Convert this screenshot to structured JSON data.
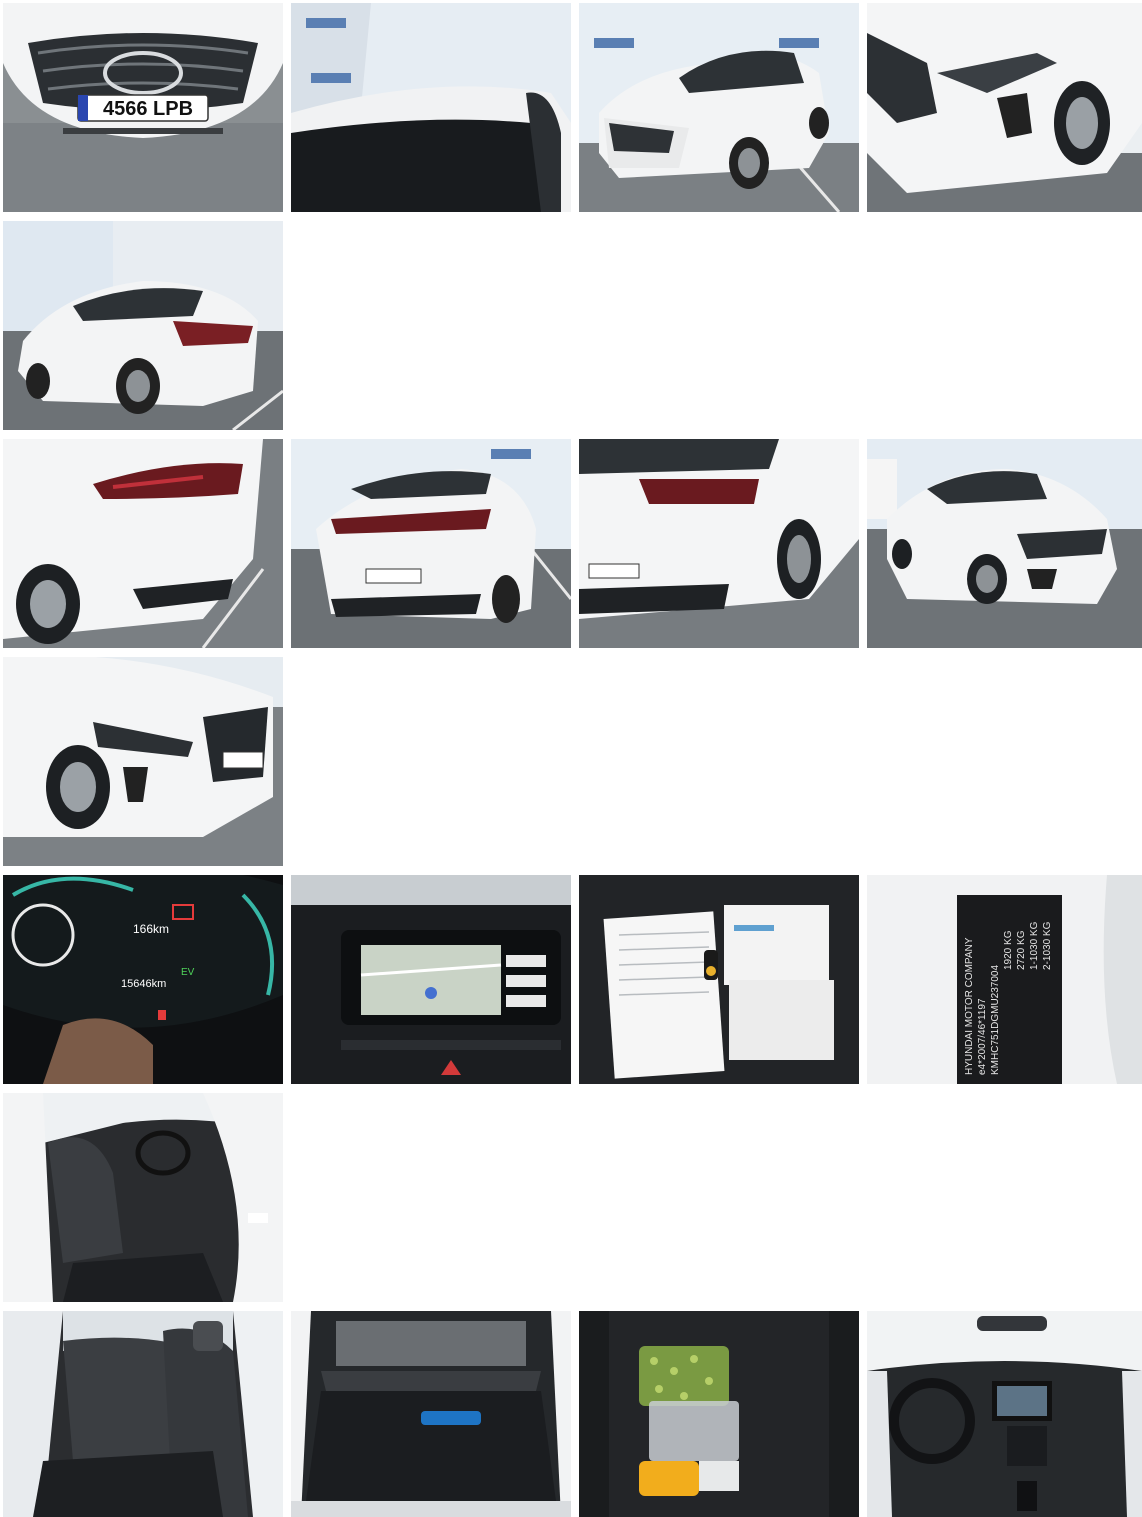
{
  "gallery": {
    "photos": [
      {
        "id": "photo-front-grille",
        "subject": "front grille with badge and plate",
        "plate": "4566 LPB"
      },
      {
        "id": "photo-roof-closeup",
        "subject": "roof and windshield close-up"
      },
      {
        "id": "photo-front-three-quarter",
        "subject": "front three-quarter view"
      },
      {
        "id": "photo-front-right-closeup",
        "subject": "front right close-up"
      },
      {
        "id": "photo-rear-left-three-quarter",
        "subject": "rear left three-quarter view"
      },
      {
        "id": "photo-rear-left-closeup",
        "subject": "rear left close-up"
      },
      {
        "id": "photo-rear-view",
        "subject": "rear view"
      },
      {
        "id": "photo-rear-right-closeup",
        "subject": "rear right close-up"
      },
      {
        "id": "photo-front-right-three-quarter",
        "subject": "front right three-quarter view"
      },
      {
        "id": "photo-front-left-closeup",
        "subject": "front left closeup"
      },
      {
        "id": "photo-instrument-cluster",
        "subject": "instrument cluster",
        "range": "166km",
        "odometer": "15646km",
        "ev_label": "EV"
      },
      {
        "id": "photo-infotainment",
        "subject": "infotainment screen"
      },
      {
        "id": "photo-documents-keys",
        "subject": "documents and key fob on seat"
      },
      {
        "id": "photo-vin-label",
        "subject": "manufacturer VIN label",
        "label_lines": [
          "HYUNDAI MOTOR COMPANY",
          "e4*2007/46*1197",
          "KMHC751DGMU237004",
          "1920 KG",
          "2720 KG",
          "1-1030 KG",
          "2-1030 KG"
        ]
      },
      {
        "id": "photo-front-interior",
        "subject": "front seats interior"
      },
      {
        "id": "photo-rear-seats",
        "subject": "rear seats"
      },
      {
        "id": "photo-trunk",
        "subject": "open trunk"
      },
      {
        "id": "photo-charging-cable-bag",
        "subject": "charging cable bag"
      },
      {
        "id": "photo-dashboard",
        "subject": "dashboard overview"
      }
    ],
    "colors": {
      "car_white": "#f2f3f4",
      "asphalt": "#5f6467",
      "wall": "#e4ebf2",
      "interior_dark": "#1d1f22",
      "screen_teal": "#37b7a6"
    }
  }
}
